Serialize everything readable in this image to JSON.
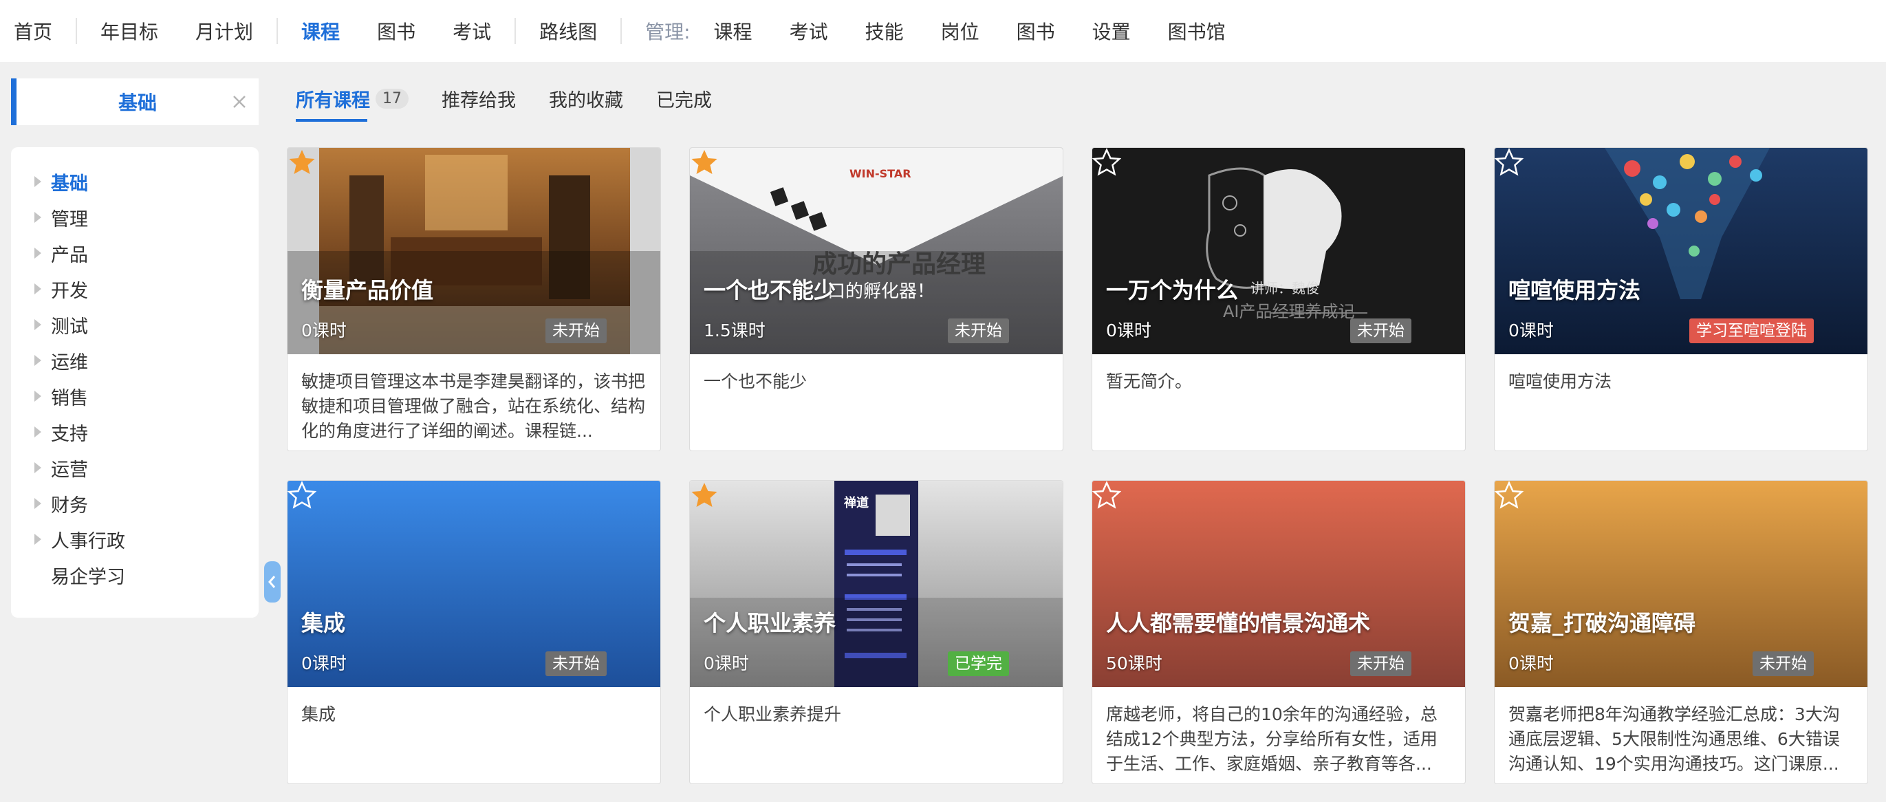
{
  "nav": {
    "items": [
      "首页",
      "年目标",
      "月计划",
      "课程",
      "图书",
      "考试",
      "路线图"
    ],
    "manage_label": "管理:",
    "manage_items": [
      "课程",
      "考试",
      "技能",
      "岗位",
      "图书",
      "设置",
      "图书馆"
    ]
  },
  "category_box": {
    "label": "基础"
  },
  "sidebar": {
    "items": [
      "基础",
      "管理",
      "产品",
      "开发",
      "测试",
      "运维",
      "销售",
      "支持",
      "运营",
      "财务",
      "人事行政",
      "易企学习"
    ]
  },
  "tabs": [
    {
      "label": "所有课程",
      "count": "17"
    },
    {
      "label": "推荐给我"
    },
    {
      "label": "我的收藏"
    },
    {
      "label": "已完成"
    }
  ],
  "courses": [
    {
      "title": "衡量产品价值",
      "hours": "0课时",
      "status": "未开始",
      "starred": true,
      "desc": "敏捷项目管理这本书是李建昊翻译的，该书把敏捷和项目管理做了融合，站在系统化、结构化的角度进行了详细的阐述。课程链..."
    },
    {
      "title": "一个也不能少",
      "hours": "1.5课时",
      "status": "未开始",
      "starred": true,
      "desc": "一个也不能少",
      "overlay_big": "成功的产品经理",
      "overlay_small": "口的孵化器！",
      "overlay_brand": "WIN-STAR"
    },
    {
      "title": "一万个为什么",
      "hours": "0课时",
      "status": "未开始",
      "starred": false,
      "desc": "暂无简介。",
      "overlay_lecturer": "讲师：魏俊",
      "overlay_sub": "AI产品经理养成记"
    },
    {
      "title": "喧喧使用方法",
      "hours": "0课时",
      "status": "学习至喧喧登陆",
      "starred": false,
      "desc": "喧喧使用方法"
    },
    {
      "title": "集成",
      "hours": "0课时",
      "status": "未开始",
      "starred": false,
      "desc": "集成"
    },
    {
      "title": "个人职业素养",
      "hours": "0课时",
      "status": "已学完",
      "starred": true,
      "desc": "个人职业素养提升",
      "overlay_poster": "禅道"
    },
    {
      "title": "人人都需要懂的情景沟通术",
      "hours": "50课时",
      "status": "未开始",
      "starred": false,
      "desc": "席越老师，将自己的10余年的沟通经验，总结成12个典型方法，分享给所有女性，适用于生活、工作、家庭婚姻、亲子教育等各..."
    },
    {
      "title": "贺嘉_打破沟通障碍",
      "hours": "0课时",
      "status": "未开始",
      "starred": false,
      "desc": "贺嘉老师把8年沟通教学经验汇总成：3大沟通底层逻辑、5大限制性沟通思维、6大错误沟通认知、19个实用沟通技巧。这门课原..."
    }
  ],
  "colors": {
    "accent": "#1e6fd9",
    "star": "#f39a2e",
    "done": "#52b043",
    "progress": "#e0574c"
  }
}
